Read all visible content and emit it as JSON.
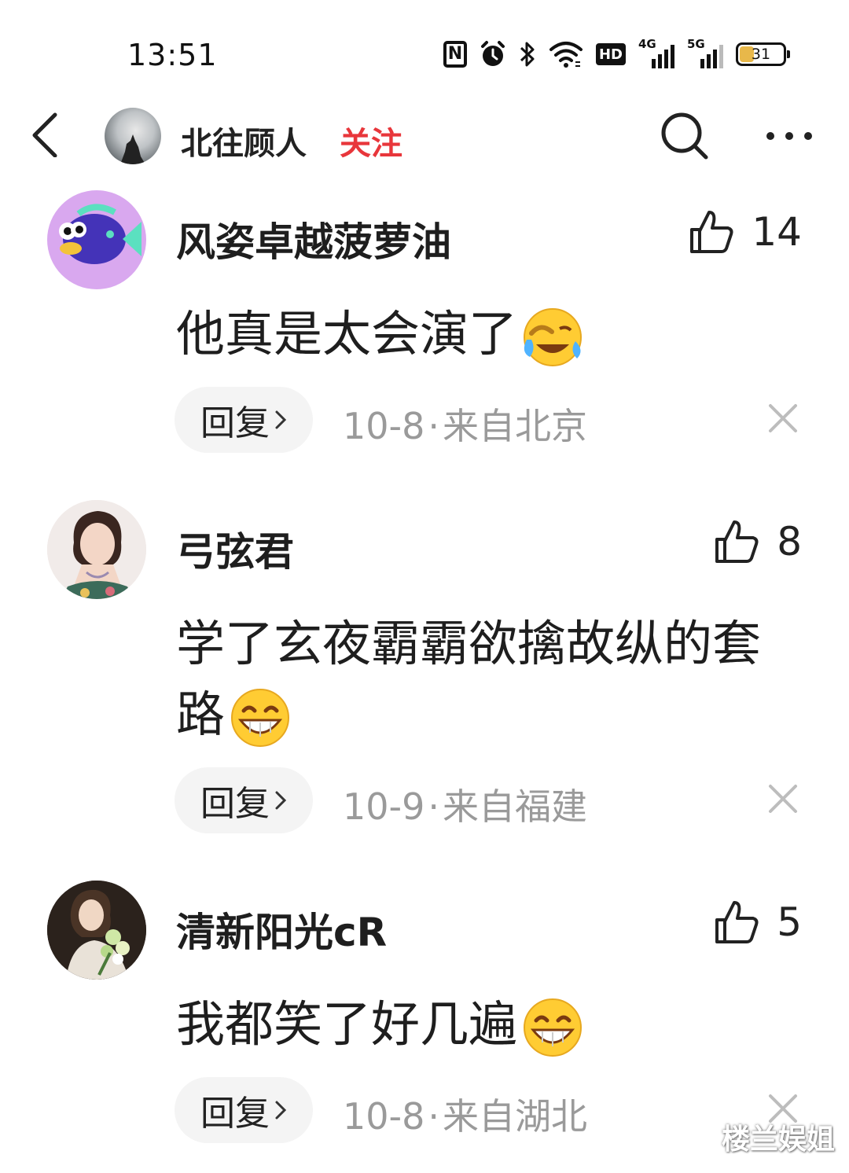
{
  "status_bar": {
    "time": "13:51",
    "hd_label": "HD",
    "net1_label": "4G",
    "net2_label": "5G",
    "nfc_label": "N",
    "battery_level": "31",
    "battery_fraction": 0.31
  },
  "header": {
    "username": "北往顾人",
    "follow_label": "关注",
    "icons": [
      "back-arrow-icon",
      "search-icon",
      "more-icon"
    ]
  },
  "comments": [
    {
      "username": "风姿卓越菠萝油",
      "likes": "14",
      "text": "他真是太会演了",
      "emoji": "laughing-crying-emoji",
      "reply_label": "回复",
      "date": "10-8",
      "separator": "·",
      "location": "来自北京"
    },
    {
      "username": "弓弦君",
      "likes": "8",
      "text": "学了玄夜霸霸欲擒故纵的套路",
      "emoji": "grinning-emoji",
      "reply_label": "回复",
      "date": "10-9",
      "separator": "·",
      "location": "来自福建"
    },
    {
      "username": "清新阳光cR",
      "likes": "5",
      "text": "我都笑了好几遍",
      "emoji": "grinning-emoji",
      "reply_label": "回复",
      "date": "10-8",
      "separator": "·",
      "location": "来自湖北"
    }
  ],
  "watermark": "楼兰娱姐",
  "colors": {
    "accent_follow": "#e8363b",
    "meta_gray": "#9a9a9a",
    "reply_bg": "#f4f4f4"
  }
}
